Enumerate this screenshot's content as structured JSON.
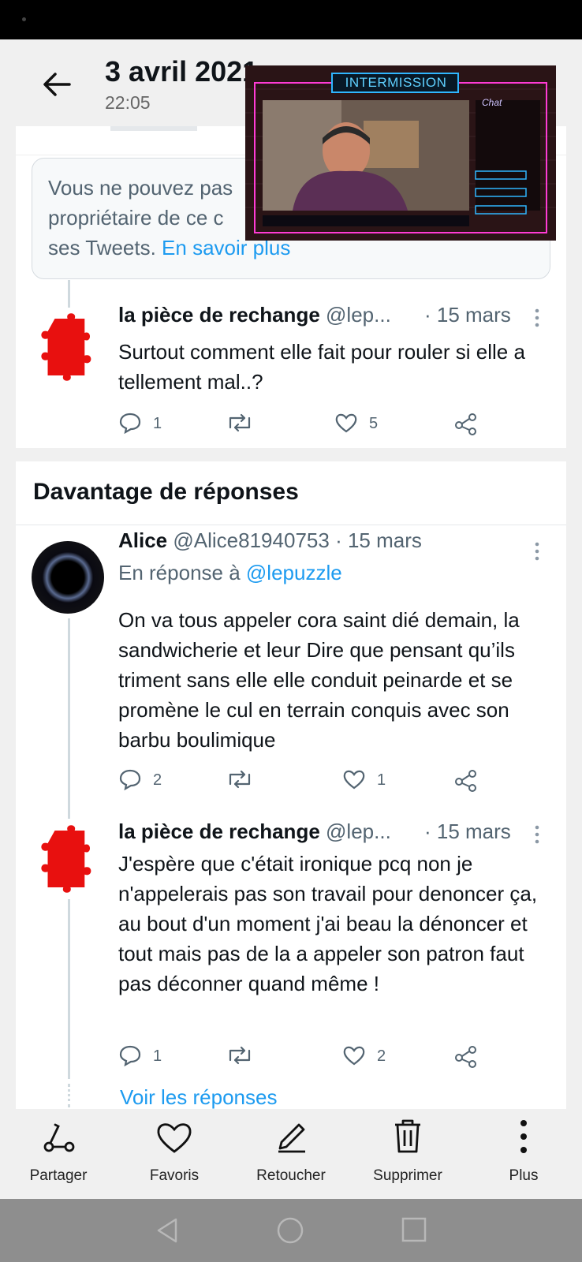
{
  "header": {
    "date": "3 avril 2021",
    "time": "22:05"
  },
  "notice": {
    "line1": "Vous ne pouvez pas",
    "line2": "propriétaire de ce c",
    "line3_prefix": "ses Tweets.",
    "learn_more": "En savoir plus"
  },
  "tweets": [
    {
      "name": "la pièce de rechange",
      "handle": "@lep...",
      "date": "· 15 mars",
      "text": "Surtout comment elle fait pour rouler si elle a tellement mal..?",
      "replies": "1",
      "likes": "5"
    },
    {
      "name": "Alice",
      "handle": "@Alice81940753",
      "date": "· 15 mars",
      "reply_to_label": "En réponse à",
      "reply_to_handle": "@lepuzzle",
      "text": "On va tous appeler cora saint dié demain, la sandwicherie et leur Dire que pensant qu’ils triment sans elle elle conduit peinarde et se promène le cul en terrain conquis avec son barbu boulimique",
      "replies": "2",
      "likes": "1"
    },
    {
      "name": "la pièce de rechange",
      "handle": "@lep...",
      "date": "· 15 mars",
      "text": "J'espère que c'était ironique pcq non je n'appelerais pas son travail pour denoncer ça, au bout d'un moment j'ai beau la dénoncer et tout mais pas de la a appeler son patron faut pas déconner quand même !",
      "replies": "1",
      "likes": "2"
    }
  ],
  "section": {
    "title": "Davantage de réponses"
  },
  "show_replies": "Voir les réponses",
  "overlay": {
    "title": "INTERMISSION",
    "chat_label": "Chat"
  },
  "toolbar": {
    "share": "Partager",
    "favorites": "Favoris",
    "edit": "Retoucher",
    "delete": "Supprimer",
    "more": "Plus"
  },
  "colors": {
    "accent": "#1d9bf0",
    "puzzle": "#e8100f",
    "neon_blue": "#2fb6ff",
    "neon_pink": "#ff3bd5"
  }
}
